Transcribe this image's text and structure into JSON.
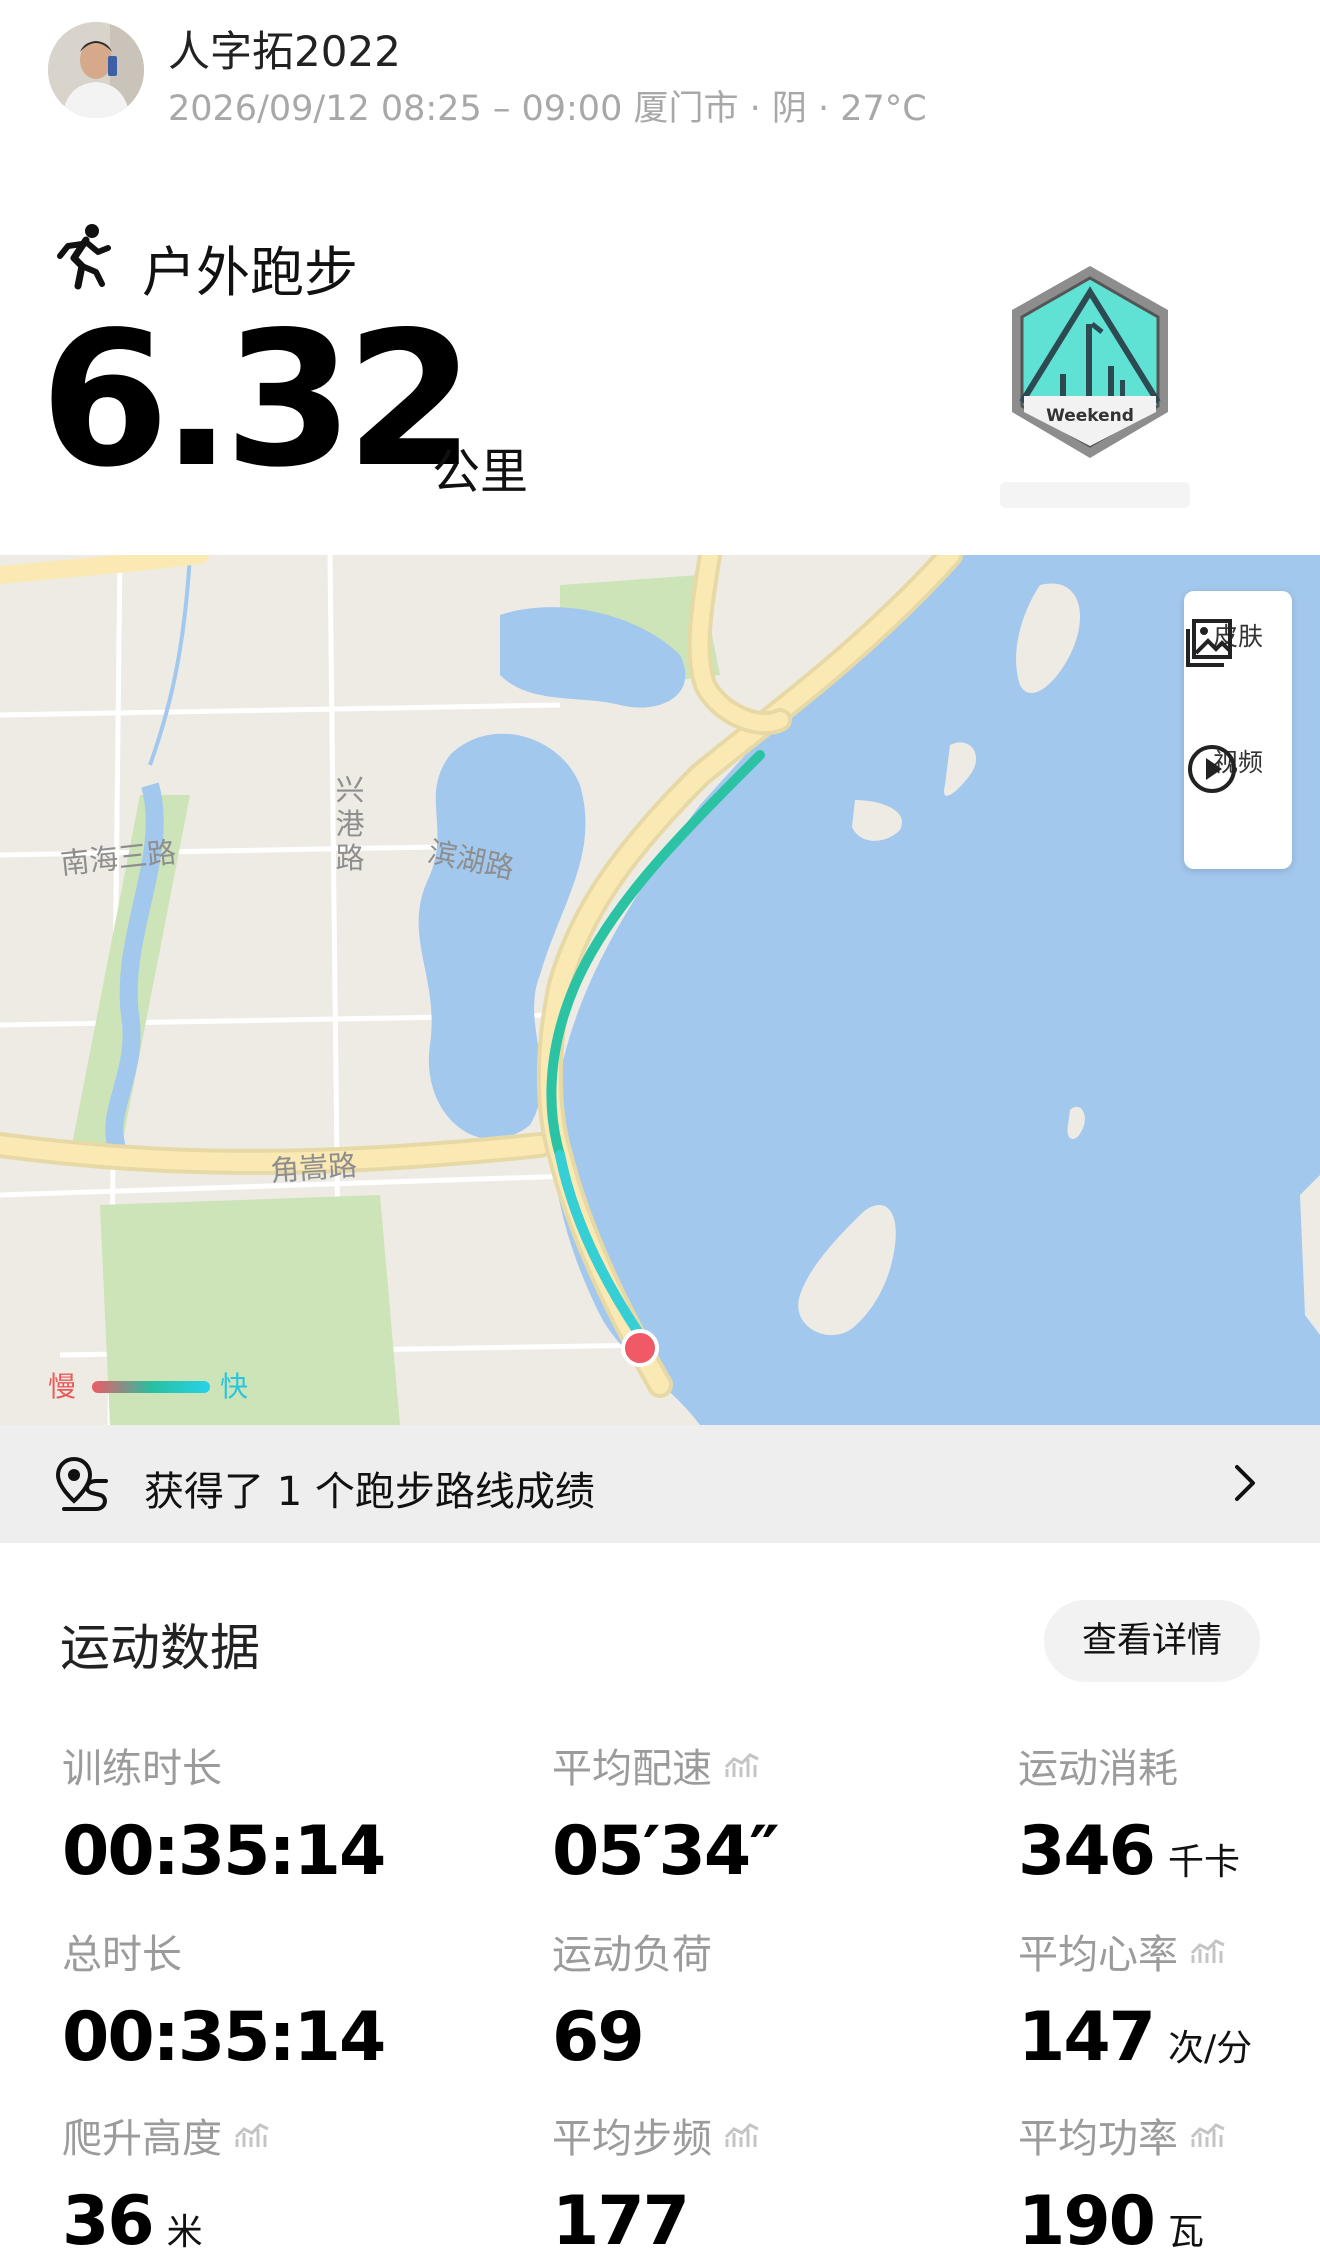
{
  "header": {
    "username": "人字拓2022",
    "meta": "2026/09/12 08:25 – 09:00 厦门市 · 阴 · 27°C"
  },
  "activity": {
    "sport": "户外跑步",
    "distance": "6.32",
    "distance_unit": "公里",
    "badge_text": "Weekend"
  },
  "map": {
    "labels": {
      "road_nanhai": "南海三路",
      "road_xinggang": "兴港路",
      "road_binhu": "滨湖路",
      "road_jiaosong": "角嵩路"
    },
    "tools": [
      {
        "label": "皮肤",
        "icon": "image-icon"
      },
      {
        "label": "视频",
        "icon": "play-icon"
      }
    ],
    "legend": {
      "slow": "慢",
      "fast": "快"
    },
    "colors": {
      "water": "#a3c8ee",
      "land": "#eeebe4",
      "route_start": "#ef5a66",
      "route": "#2cc3a5"
    }
  },
  "achievement": {
    "text": "获得了 1 个跑步路线成绩"
  },
  "stats": {
    "title": "运动数据",
    "details_button": "查看详情",
    "items": [
      {
        "label": "训练时长",
        "value": "00:35:14",
        "unit": "",
        "has_chart": false
      },
      {
        "label": "平均配速",
        "value": "05′34″",
        "unit": "",
        "has_chart": true
      },
      {
        "label": "运动消耗",
        "value": "346",
        "unit": "千卡",
        "has_chart": false
      },
      {
        "label": "总时长",
        "value": "00:35:14",
        "unit": "",
        "has_chart": false
      },
      {
        "label": "运动负荷",
        "value": "69",
        "unit": "",
        "has_chart": false
      },
      {
        "label": "平均心率",
        "value": "147",
        "unit": "次/分",
        "has_chart": true
      },
      {
        "label": "爬升高度",
        "value": "36",
        "unit": "米",
        "has_chart": true
      },
      {
        "label": "平均步频",
        "value": "177",
        "unit": "",
        "has_chart": true
      },
      {
        "label": "平均功率",
        "value": "190",
        "unit": "瓦",
        "has_chart": true
      }
    ]
  }
}
